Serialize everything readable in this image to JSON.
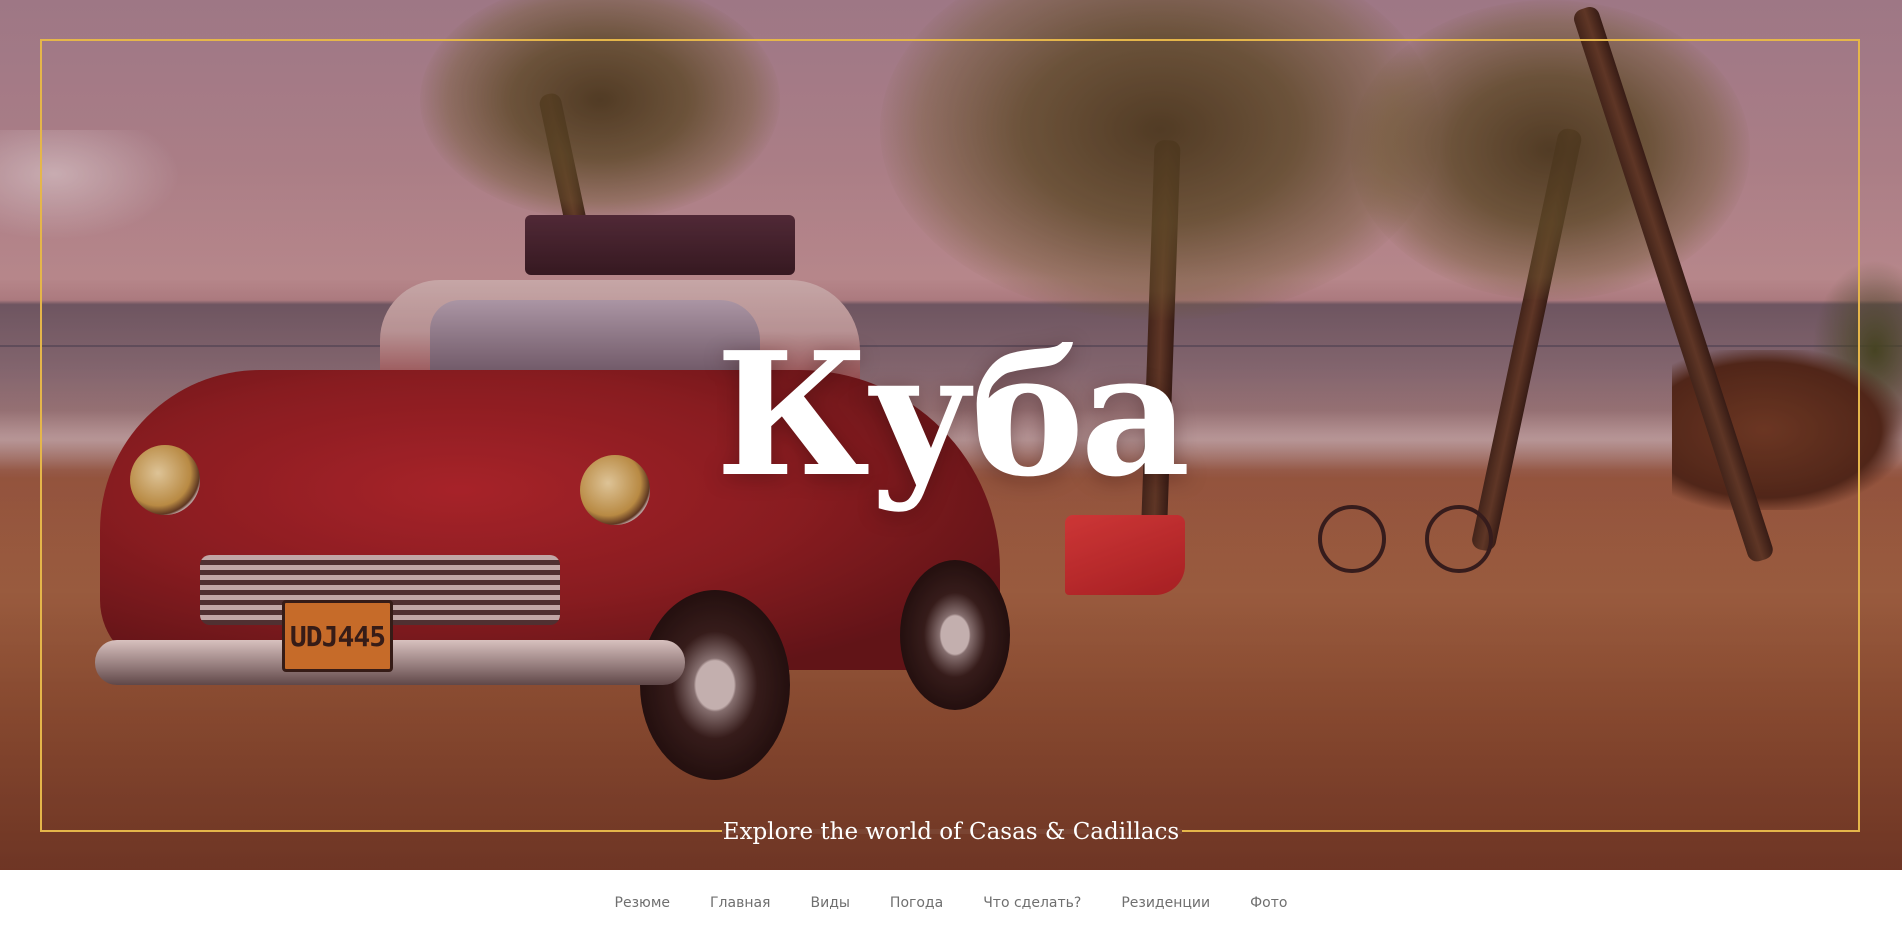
{
  "hero": {
    "title": "Куба",
    "tagline": "Explore the world of Casas & Cadillacs",
    "frame_color": "#e5b64a",
    "license_plate": "UDJ445"
  },
  "nav": {
    "items": [
      {
        "label": "Резюме"
      },
      {
        "label": "Главная"
      },
      {
        "label": "Виды"
      },
      {
        "label": "Погода"
      },
      {
        "label": "Что сделать?"
      },
      {
        "label": "Резиденции"
      },
      {
        "label": "Фото"
      }
    ]
  }
}
